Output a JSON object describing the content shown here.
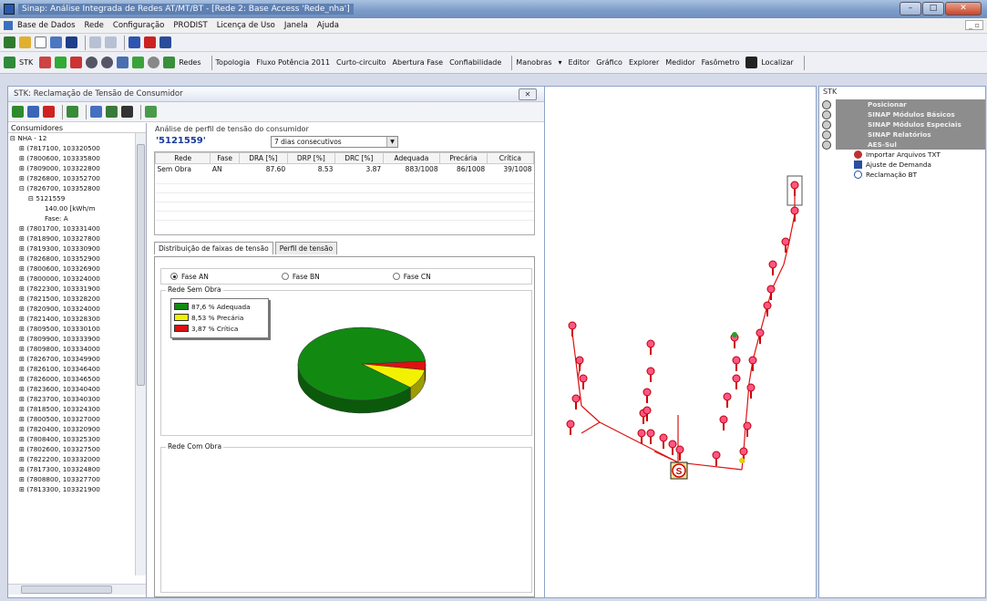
{
  "window": {
    "title": "Sinap: Análise Integrada de Redes AT/MT/BT - [Rede 2: Base Access 'Rede_nha']",
    "controls": {
      "minimize": "–",
      "maximize": "□",
      "close": "✕"
    }
  },
  "menu": [
    "Base de Dados",
    "Rede",
    "Configuração",
    "PRODIST",
    "Licença de Uso",
    "Janela",
    "Ajuda"
  ],
  "mdi_controls": "_ ▫",
  "toolbar2": {
    "stk": "STK",
    "redes": "Redes",
    "items": [
      "Topologia",
      "Fluxo Potência 2011",
      "Curto-circuito",
      "Abertura Fase",
      "Confiabilidade"
    ],
    "items2": [
      "Manobras",
      "Editor",
      "Gráfico",
      "Explorer",
      "Medidor",
      "Fasômetro"
    ],
    "localizar": "Localizar"
  },
  "stk_panel": {
    "title": "STK: Reclamação de Tensão de Consumidor",
    "close": "✕",
    "tree_header": "Consumidores",
    "tree_root": "NHA - 12",
    "tree_items_before": [
      "(7817100, 103320500",
      "(7800600, 103335800",
      "(7809000, 103322800",
      "(7826800, 103352700"
    ],
    "tree_expanded": "(7826700, 103352800",
    "tree_sub": "5121559",
    "tree_sub_value": "140.00 [kWh/m",
    "tree_sub_fase": "Fase: A",
    "tree_items_after": [
      "(7801700, 103331400",
      "(7818900, 103327800",
      "(7819300, 103330900",
      "(7826800, 103352900",
      "(7800600, 103326900",
      "(7800000, 103324000",
      "(7822300, 103331900",
      "(7821500, 103328200",
      "(7820900, 103324000",
      "(7821400, 103328300",
      "(7809500, 103330100",
      "(7809900, 103333900",
      "(7809800, 103334000",
      "(7826700, 103349900",
      "(7826100, 103346400",
      "(7826000, 103346500",
      "(7823600, 103340400",
      "(7823700, 103340300",
      "(7818500, 103324300",
      "(7800500, 103327000",
      "(7820400, 103320900",
      "(7808400, 103325300",
      "(7802600, 103327500",
      "(7822200, 103332000",
      "(7817300, 103324800",
      "(7808800, 103327700",
      "(7813300, 103321900"
    ],
    "analysis_title": "Análise de perfil de tensão do consumidor",
    "consumer_id": "'5121559'",
    "period": "7 dias consecutivos",
    "table": {
      "headers": [
        "Rede",
        "Fase",
        "DRA [%]",
        "DRP [%]",
        "DRC [%]",
        "Adequada",
        "Precária",
        "Crítica"
      ],
      "rows": [
        [
          "Sem Obra",
          "AN",
          "87.60",
          "8.53",
          "3.87",
          "883/1008",
          "86/1008",
          "39/1008"
        ]
      ]
    },
    "tabs": [
      "Distribuição de faixas de tensão",
      "Perfil de tensão"
    ],
    "phases": [
      "Fase AN",
      "Fase BN",
      "Fase CN"
    ],
    "selected_phase": "Fase AN",
    "group_sem_obra": "Rede Sem Obra",
    "group_com_obra": "Rede Com Obra"
  },
  "chart_data": {
    "type": "pie",
    "title": "",
    "series": [
      {
        "name": "87,6 % Adequada",
        "value": 87.6,
        "color": "#128a12"
      },
      {
        "name": "8,53 % Precária",
        "value": 8.53,
        "color": "#f2f200"
      },
      {
        "name": "3,87 % Crítica",
        "value": 3.87,
        "color": "#dd1111"
      }
    ]
  },
  "sidebar": {
    "title": "STK",
    "groups": [
      "Posicionar",
      "SINAP Módulos Básicos",
      "SINAP Módulos Especiais",
      "SINAP Relatórios",
      "AES-Sul"
    ],
    "children": [
      "Importar Arquivos TXT",
      "Ajuste de Demanda",
      "Reclamação BT"
    ]
  },
  "map": {
    "marker_label": "S"
  }
}
